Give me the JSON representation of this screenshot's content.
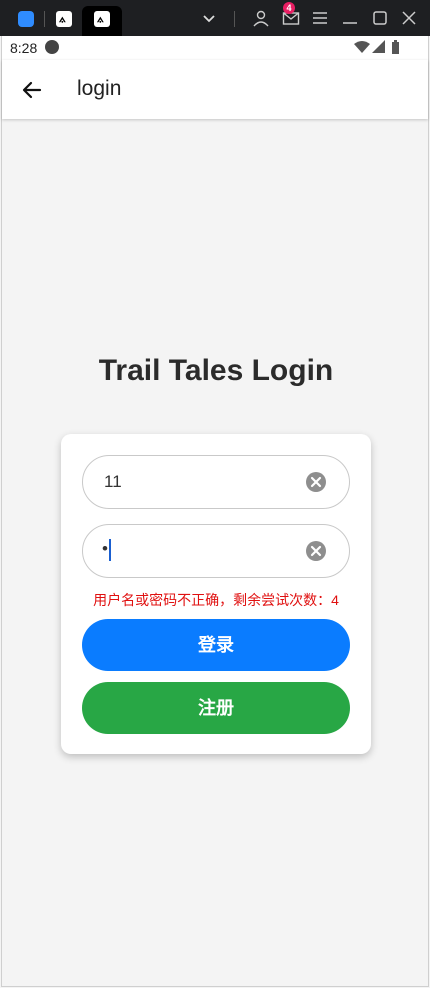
{
  "chrome": {
    "mail_badge": "4"
  },
  "status_bar": {
    "time": "8:28"
  },
  "app_bar": {
    "title": "login"
  },
  "page": {
    "headline": "Trail Tales Login"
  },
  "form": {
    "username_value": "11",
    "password_value": "•",
    "error_message": "用户名或密码不正确，剩余尝试次数：4",
    "login_label": "登录",
    "register_label": "注册"
  },
  "colors": {
    "login_button": "#0a7cff",
    "register_button": "#28a745",
    "error_text": "#e01010"
  }
}
